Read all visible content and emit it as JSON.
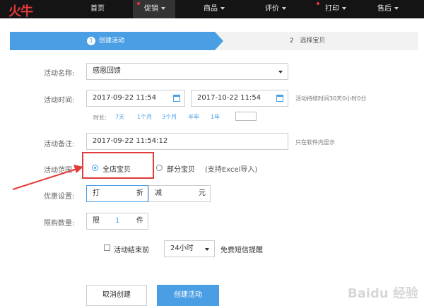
{
  "nav": {
    "logo": "火牛",
    "items": [
      {
        "label": "首页",
        "dot": false,
        "caret": false,
        "active": false
      },
      {
        "label": "促销",
        "dot": true,
        "caret": true,
        "active": true
      },
      {
        "label": "商品",
        "dot": false,
        "caret": true,
        "active": false
      },
      {
        "label": "评价",
        "dot": false,
        "caret": true,
        "active": false
      },
      {
        "label": "打印",
        "dot": true,
        "caret": true,
        "active": false
      },
      {
        "label": "售后",
        "dot": false,
        "caret": true,
        "active": false
      }
    ]
  },
  "steps": {
    "step1_num": "1",
    "step1_label": "创建活动",
    "step2_num": "2",
    "step2_label": "选择宝贝"
  },
  "form": {
    "name_label": "活动名称:",
    "name_value": "感恩回馈",
    "time_label": "活动时间:",
    "start_time": "2017-09-22 11:54",
    "end_time": "2017-10-22 11:54",
    "duration_hint": "活动持续时间30天0小时0分",
    "quick_prefix": "时长:",
    "quick_options": [
      "7天",
      "1个月",
      "3个月",
      "半年",
      "1年"
    ],
    "remark_label": "活动备注:",
    "remark_value": "2017-09-22 11:54:12",
    "remark_hint": "只在软件内显示",
    "scope_label": "活动范围:",
    "scope_all": "全店宝贝",
    "scope_part": "部分宝贝",
    "scope_part_hint": "(支持Excel导入)",
    "discount_label": "优惠设置:",
    "discount_prefix": "打",
    "discount_suffix": "折",
    "reduce_prefix": "减",
    "reduce_suffix": "元",
    "limit_label": "限购数量:",
    "limit_prefix": "限",
    "limit_value": "1",
    "limit_suffix": "件",
    "remind_checkbox_label": "活动结束前",
    "remind_select": "24小时",
    "remind_suffix": "免费短信提醒"
  },
  "buttons": {
    "cancel": "取消创建",
    "create": "创建活动"
  },
  "watermark": "Baidu 经验",
  "colors": {
    "accent": "#4a9fe4",
    "highlight": "#e23b3b",
    "nav_bg": "#141414"
  }
}
